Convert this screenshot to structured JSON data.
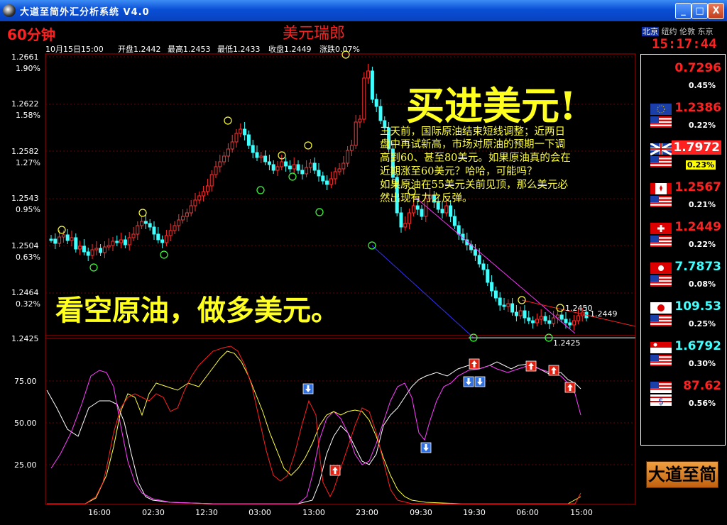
{
  "window": {
    "title": "大道至简外汇分析系统 V4.0",
    "buttons": [
      "_",
      "□",
      "X"
    ]
  },
  "header": {
    "period": "60分钟",
    "symbol": "美元瑞郎",
    "info": {
      "datetime": "10月15日15:00",
      "open": "开盘1.2442",
      "high": "最高1.2453",
      "low": "最低1.2433",
      "close": "收盘1.2449",
      "change": "涨跌0.07%"
    }
  },
  "price_axis": [
    {
      "price": "1.2661",
      "pct": "1.90%"
    },
    {
      "price": "1.2622",
      "pct": "1.58%"
    },
    {
      "price": "1.2582",
      "pct": "1.27%"
    },
    {
      "price": "1.2543",
      "pct": "0.95%"
    },
    {
      "price": "1.2504",
      "pct": "0.63%"
    },
    {
      "price": "1.2464",
      "pct": "0.32%"
    },
    {
      "price": "1.2425",
      "pct": ""
    }
  ],
  "osc_axis": [
    "75.00",
    "50.00",
    "25.00"
  ],
  "time_axis": [
    "16:00",
    "02:30",
    "12:30",
    "03:00",
    "13:00",
    "23:00",
    "09:30",
    "19:30",
    "06:00",
    "15:00"
  ],
  "annotations": {
    "headline": "买进美元!",
    "body": [
      "三天前，国际原油结束短线调整；近两日",
      "盘中再试新高，市场对原油的预期一下调",
      "高到60、甚至80美元。如果原油真的会在",
      "近期涨至60美元？哈哈，可能吗？",
      "如果原油在55美元关前见顶，那么美元必",
      "然出现有力之反弹。"
    ],
    "slogan": "看空原油，做多美元。",
    "price_label_1": "1.2450",
    "price_label_2": "1.2449",
    "price_label_3": "1.2425"
  },
  "clock": {
    "cities": [
      "北京",
      "纽约",
      "伦敦",
      "东京"
    ],
    "active_city": "北京",
    "time": "15:17:44"
  },
  "watchlist": [
    {
      "flag": "aud-flag",
      "rate": "0.7296",
      "pct": "0.45%",
      "color": "#ff2020"
    },
    {
      "flag": "eur-usd-flag",
      "rate": "1.2386",
      "pct": "0.22%",
      "color": "#ff2020"
    },
    {
      "flag": "gbp-usd-flag",
      "rate": "1.7972",
      "pct": "0.23%",
      "color": "#ff2020",
      "highlight": true
    },
    {
      "flag": "cad-usd-flag",
      "rate": "1.2567",
      "pct": "0.21%",
      "color": "#ff2020"
    },
    {
      "flag": "chf-usd-flag",
      "rate": "1.2449",
      "pct": "0.22%",
      "color": "#ff2020"
    },
    {
      "flag": "hkd-usd-flag",
      "rate": "7.7873",
      "pct": "0.08%",
      "color": "#40ffff"
    },
    {
      "flag": "jpy-usd-flag",
      "rate": "109.53",
      "pct": "0.25%",
      "color": "#40ffff"
    },
    {
      "flag": "sgd-usd-flag",
      "rate": "1.6792",
      "pct": "0.30%",
      "color": "#40ffff"
    },
    {
      "flag": "usd-oil-flag",
      "rate": "87.62",
      "pct": "0.56%",
      "color": "#ff2020"
    }
  ],
  "logo": "大道至简"
}
